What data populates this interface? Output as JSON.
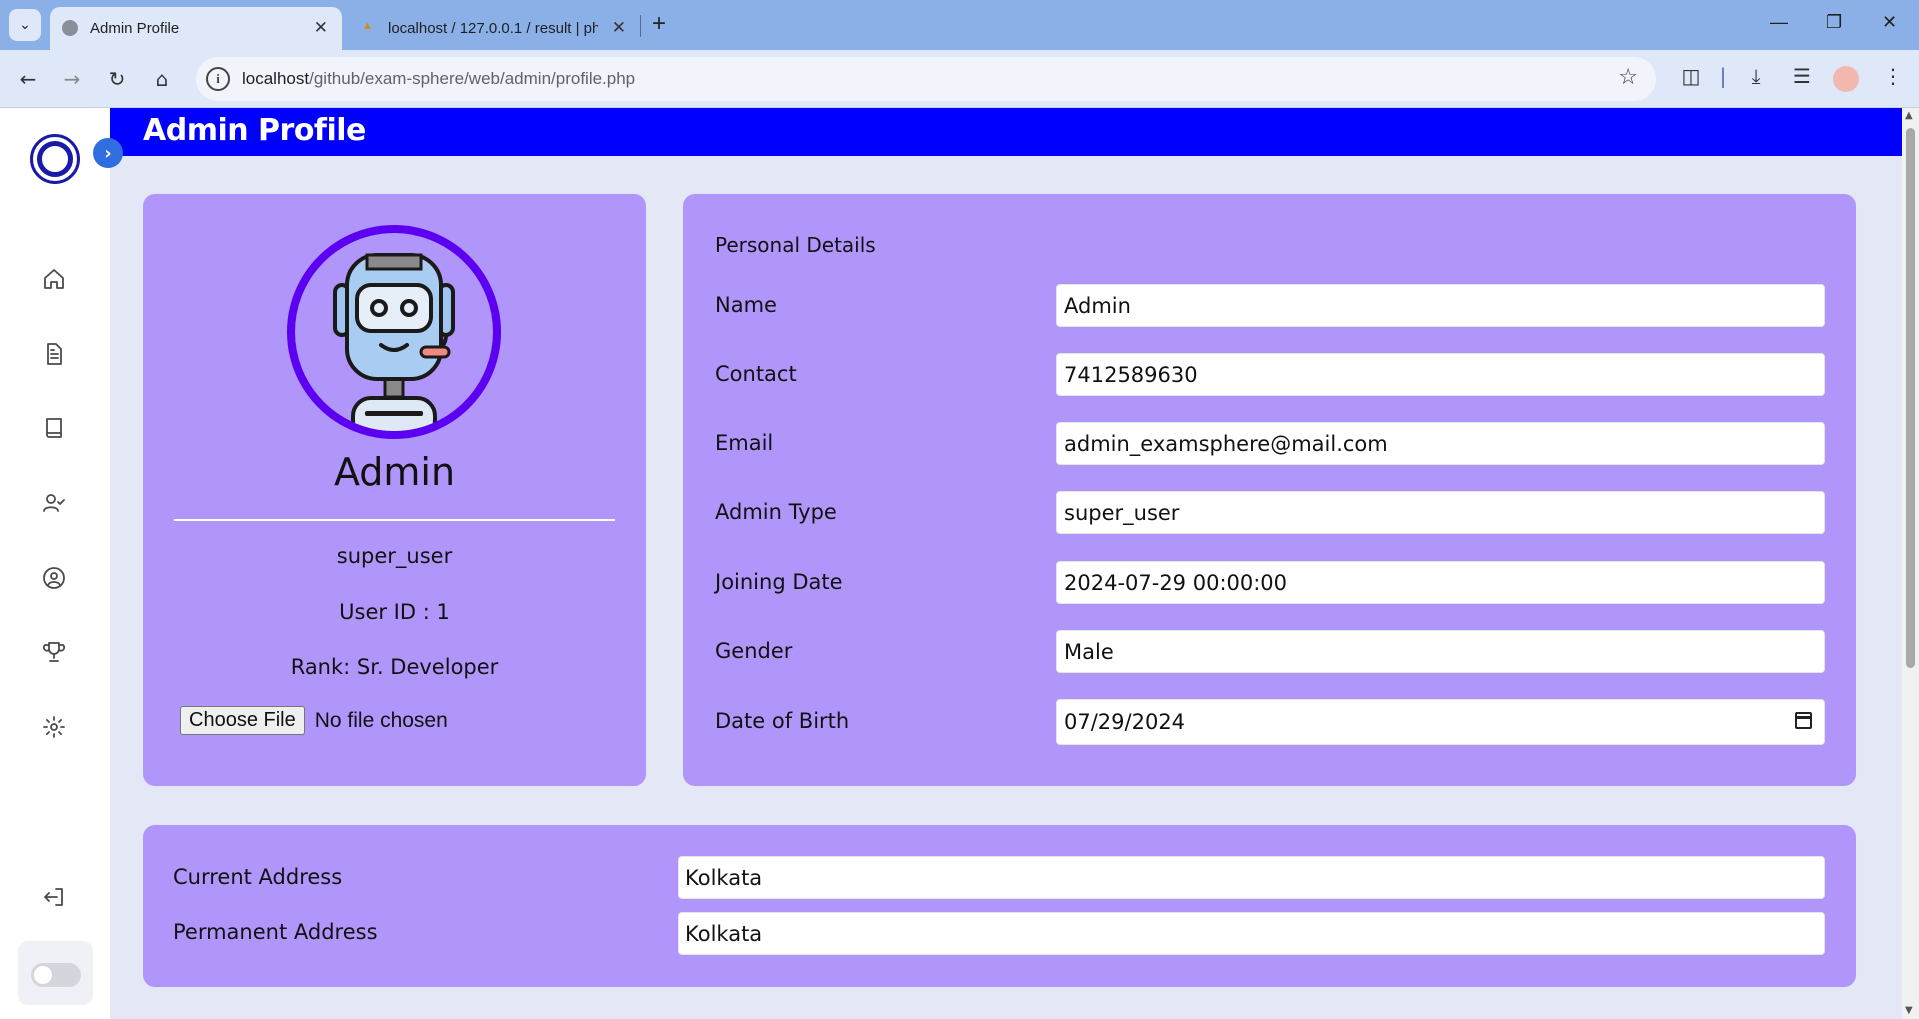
{
  "browser": {
    "tabs": [
      {
        "title": "Admin Profile",
        "active": true
      },
      {
        "title": "localhost / 127.0.0.1 / result | ph",
        "active": false
      }
    ],
    "url_host": "localhost",
    "url_path": "/github/exam-sphere/web/admin/profile.php"
  },
  "page": {
    "title": "Admin Profile"
  },
  "profile": {
    "name": "Admin",
    "admin_type": "super_user",
    "user_id": "User ID : 1",
    "rank": "Rank: Sr. Developer",
    "file_button": "Choose File",
    "file_status": "No file chosen"
  },
  "details": {
    "section_title": "Personal Details",
    "fields": [
      {
        "label": "Name",
        "value": "Admin"
      },
      {
        "label": "Contact",
        "value": "7412589630"
      },
      {
        "label": "Email",
        "value": "admin_examsphere@mail.com"
      },
      {
        "label": "Admin Type",
        "value": "super_user"
      },
      {
        "label": "Joining Date",
        "value": "2024-07-29 00:00:00"
      },
      {
        "label": "Gender",
        "value": "Male"
      },
      {
        "label": "Date of Birth",
        "value": "07/29/2024"
      }
    ]
  },
  "address": {
    "fields": [
      {
        "label": "Current Address",
        "value": "Kolkata"
      },
      {
        "label": "Permanent Address",
        "value": "Kolkata"
      }
    ]
  },
  "sidebar": {
    "icons": [
      "home-icon",
      "document-icon",
      "book-icon",
      "user-check-icon",
      "user-circle-icon",
      "trophy-icon",
      "settings-icon",
      "logout-icon"
    ]
  },
  "colors": {
    "header": "#0000ff",
    "card": "#b095fb",
    "avatar_ring": "#5b00f0",
    "page_bg": "#e4e7f6"
  }
}
